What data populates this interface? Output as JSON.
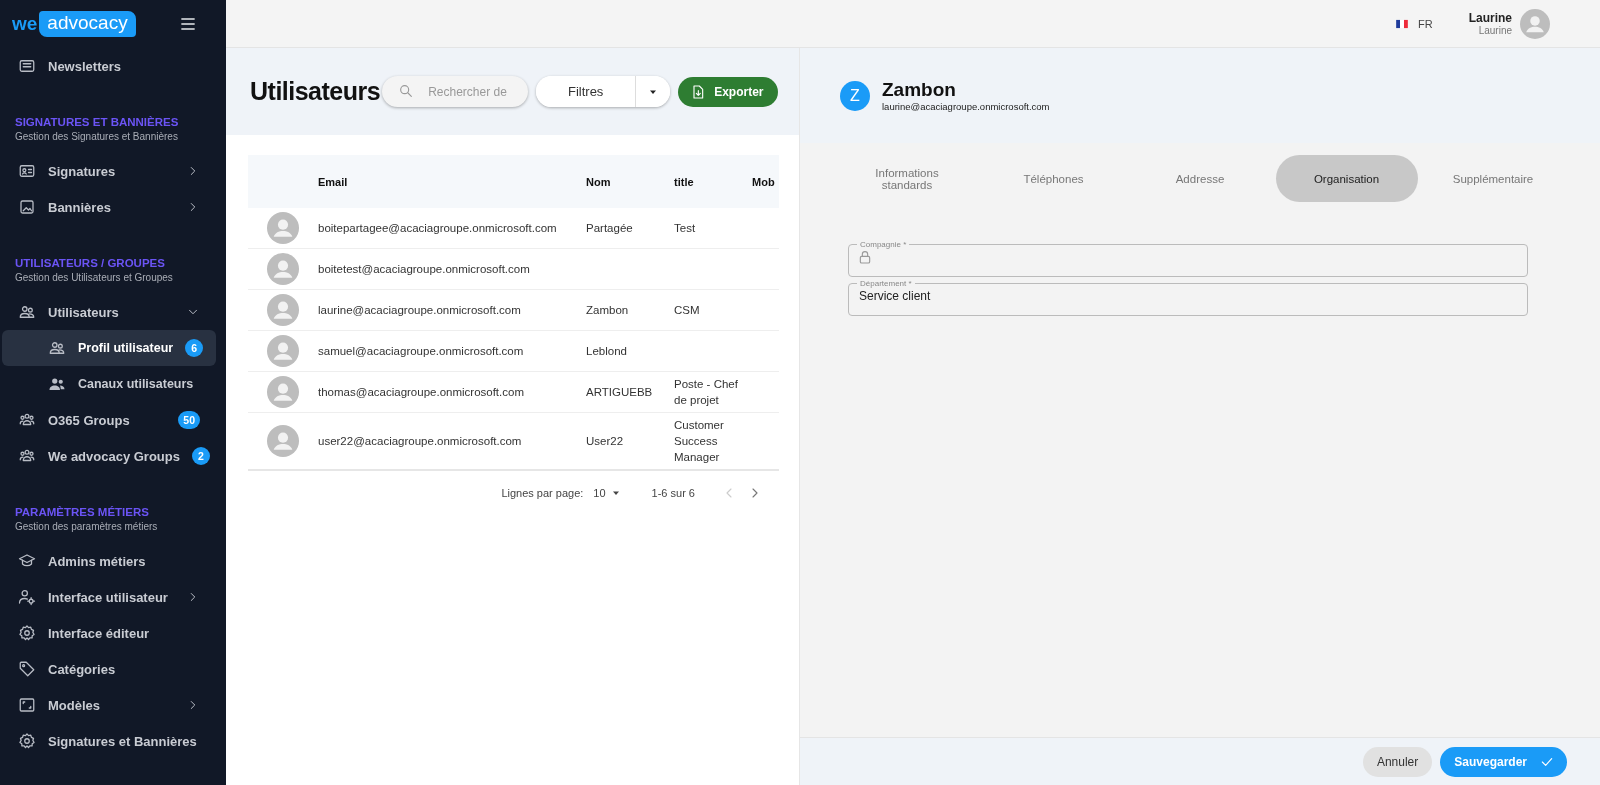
{
  "sidebar": {
    "logo": {
      "prefix": "we",
      "word": "advocacy"
    },
    "top_items": [
      {
        "label": "Newsletters",
        "selected": false
      }
    ],
    "sections": [
      {
        "title": "SIGNATURES ET BANNIÈRES",
        "subtitle": "Gestion des Signatures et Bannières",
        "items": [
          {
            "label": "Signatures",
            "selected": false,
            "expanded": false
          },
          {
            "label": "Bannières",
            "selected": false,
            "expanded": false
          }
        ]
      },
      {
        "title": "UTILISATEURS / GROUPES",
        "subtitle": "Gestion des Utilisateurs et Groupes",
        "items": [
          {
            "label": "Utilisateurs",
            "selected": false,
            "expanded": true,
            "children": [
              {
                "label": "Profil utilisateur",
                "selected": true,
                "badge": "6"
              },
              {
                "label": "Canaux utilisateurs",
                "selected": false
              }
            ]
          },
          {
            "label": "O365 Groups",
            "selected": false,
            "badge": "50"
          },
          {
            "label": "We advocacy Groups",
            "selected": false,
            "badge": "2"
          }
        ]
      },
      {
        "title": "PARAMÈTRES MÉTIERS",
        "subtitle": "Gestion des paramètres métiers",
        "items": [
          {
            "label": "Admins métiers",
            "selected": false
          },
          {
            "label": "Interface utilisateur",
            "selected": false,
            "expanded": false
          },
          {
            "label": "Interface éditeur",
            "selected": false
          },
          {
            "label": "Catégories",
            "selected": false
          },
          {
            "label": "Modèles",
            "selected": false,
            "expanded": false
          },
          {
            "label": "Signatures et Bannières",
            "selected": false
          }
        ]
      }
    ]
  },
  "topbar": {
    "language": "FR",
    "user": {
      "name": "Laurine",
      "subtitle": "Laurine"
    }
  },
  "users_panel": {
    "title": "Utilisateurs",
    "search": {
      "placeholder": "Rechercher de"
    },
    "filter_button": "Filtres",
    "export_button": "Exporter",
    "table": {
      "columns": [
        "Email",
        "Nom",
        "title",
        "Mob"
      ],
      "rows": [
        {
          "email": "boitepartagee@acaciagroupe.onmicrosoft.com",
          "nom": "Partagée",
          "title": "Test"
        },
        {
          "email": "boitetest@acaciagroupe.onmicrosoft.com"
        },
        {
          "email": "laurine@acaciagroupe.onmicrosoft.com",
          "nom": "Zambon",
          "title": "CSM"
        },
        {
          "email": "samuel@acaciagroupe.onmicrosoft.com",
          "nom": "Leblond"
        },
        {
          "email": "thomas@acaciagroupe.onmicrosoft.com",
          "nom": "ARTIGUEBB",
          "title": "Poste - Chef de projet"
        },
        {
          "email": "user22@acaciagroupe.onmicrosoft.com",
          "nom": "User22",
          "title": "Customer Success Manager"
        }
      ]
    },
    "pagination": {
      "rows_label": "Lignes par page:",
      "rows_per_page": "10",
      "range": "1-6 sur 6",
      "prev_disabled": true,
      "next_disabled": false
    }
  },
  "detail_panel": {
    "initial": "Z",
    "name": "Zambon",
    "email": "laurine@acaciagroupe.onmicrosoft.com",
    "tabs": [
      {
        "label": "Informations standards",
        "selected": false
      },
      {
        "label": "Téléphones",
        "selected": false
      },
      {
        "label": "Addresse",
        "selected": false
      },
      {
        "label": "Organisation",
        "selected": true
      },
      {
        "label": "Supplémentaire",
        "selected": false
      }
    ],
    "fields": [
      {
        "label": "Compagnie *",
        "locked": true
      },
      {
        "label": "Département *",
        "value": "Service client",
        "locked": false
      }
    ],
    "buttons": [
      {
        "label": "Annuler",
        "kind": "cancel"
      },
      {
        "label": "Sauvegarder",
        "kind": "save"
      }
    ]
  }
}
